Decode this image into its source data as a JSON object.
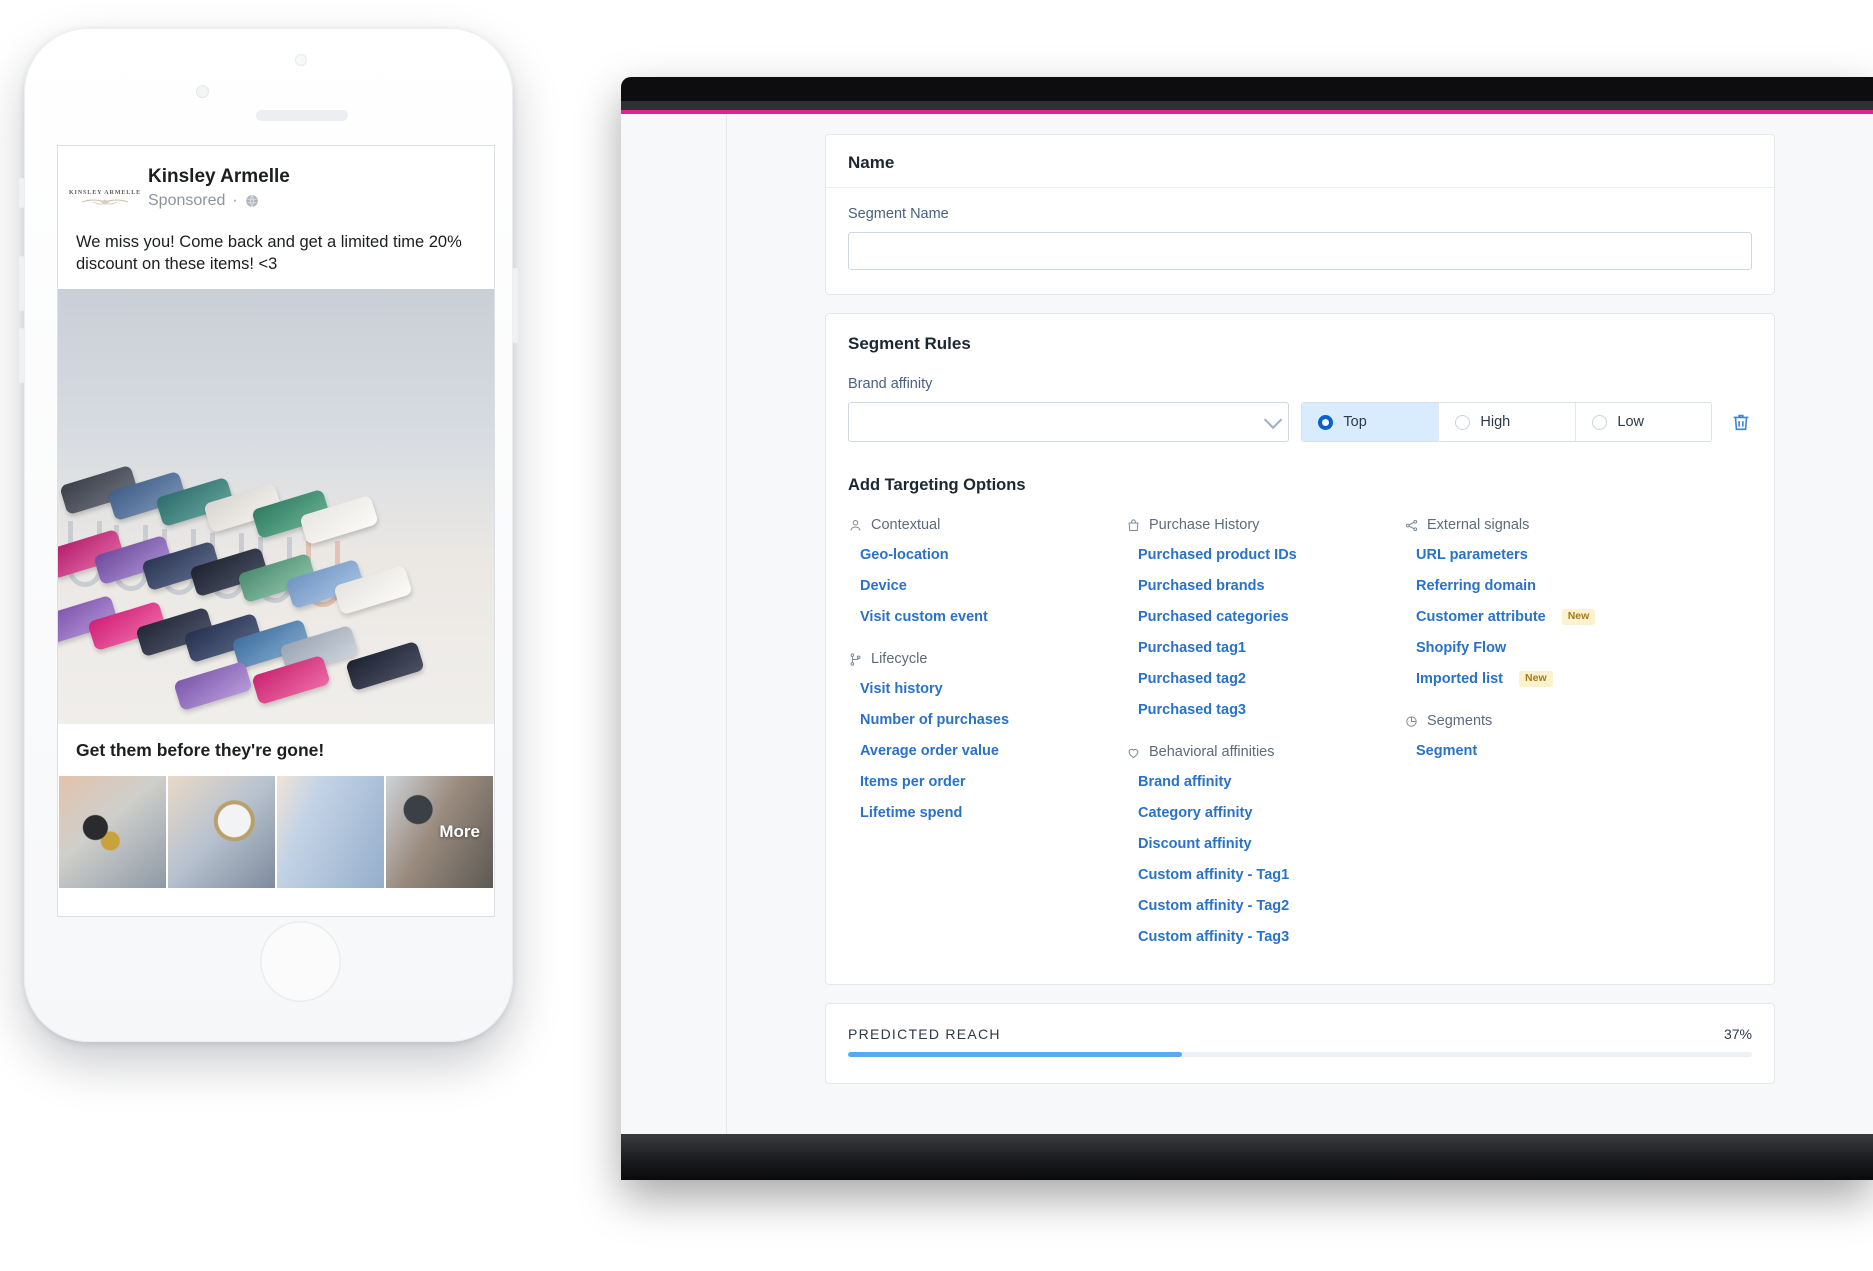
{
  "tablet": {
    "accent_color": "#e0219b",
    "name_card": {
      "title": "Name",
      "field_label": "Segment Name",
      "field_value": "",
      "field_placeholder": ""
    },
    "rules_card": {
      "title": "Segment Rules",
      "rule_label": "Brand affinity",
      "select_value": "",
      "segments": [
        {
          "label": "Top",
          "selected": true
        },
        {
          "label": "High",
          "selected": false
        },
        {
          "label": "Low",
          "selected": false
        }
      ],
      "delete_icon": "trash-icon"
    },
    "targeting": {
      "title": "Add Targeting Options",
      "columns": [
        {
          "groups": [
            {
              "heading": "Contextual",
              "icon": "person-icon",
              "items": [
                {
                  "label": "Geo-location"
                },
                {
                  "label": "Device"
                },
                {
                  "label": "Visit custom event"
                }
              ]
            },
            {
              "heading": "Lifecycle",
              "icon": "branch-icon",
              "items": [
                {
                  "label": "Visit history"
                },
                {
                  "label": "Number of purchases"
                },
                {
                  "label": "Average order value"
                },
                {
                  "label": "Items per order"
                },
                {
                  "label": "Lifetime spend"
                }
              ]
            }
          ]
        },
        {
          "groups": [
            {
              "heading": "Purchase History",
              "icon": "bag-icon",
              "items": [
                {
                  "label": "Purchased product IDs"
                },
                {
                  "label": "Purchased brands"
                },
                {
                  "label": "Purchased categories"
                },
                {
                  "label": "Purchased tag1"
                },
                {
                  "label": "Purchased tag2"
                },
                {
                  "label": "Purchased tag3"
                }
              ]
            },
            {
              "heading": "Behavioral affinities",
              "icon": "heart-icon",
              "items": [
                {
                  "label": "Brand affinity"
                },
                {
                  "label": "Category affinity"
                },
                {
                  "label": "Discount affinity"
                },
                {
                  "label": "Custom affinity - Tag1"
                },
                {
                  "label": "Custom affinity - Tag2"
                },
                {
                  "label": "Custom affinity - Tag3"
                }
              ]
            }
          ]
        },
        {
          "groups": [
            {
              "heading": "External signals",
              "icon": "share-nodes-icon",
              "items": [
                {
                  "label": "URL parameters"
                },
                {
                  "label": "Referring domain"
                },
                {
                  "label": "Customer attribute",
                  "badge": "New"
                },
                {
                  "label": "Shopify Flow"
                },
                {
                  "label": "Imported list",
                  "badge": "New"
                }
              ]
            },
            {
              "heading": "Segments",
              "icon": "pie-chart-icon",
              "items": [
                {
                  "label": "Segment"
                }
              ]
            }
          ]
        }
      ]
    },
    "predicted_reach": {
      "label": "PREDICTED REACH",
      "percent_text": "37%",
      "percent_value": 37,
      "bar_color": "#5aa8f0"
    }
  },
  "phone": {
    "ad": {
      "logo_text": "KINSLEY ARMELLE",
      "page_name": "Kinsley Armelle",
      "sponsored_label": "Sponsored",
      "separator": "·",
      "audience_icon": "globe-icon",
      "body_text": "We miss you! Come back and get a limited time 20% discount on these items! <3",
      "hero_alt": "druzy-stone-rings-photo",
      "caption": "Get them before they're gone!",
      "thumbnails": [
        {
          "alt": "stacked-bracelets-thumbnail"
        },
        {
          "alt": "watch-and-bracelets-thumbnail"
        },
        {
          "alt": "necklace-sweater-thumbnail"
        },
        {
          "alt": "beaded-bracelet-thumbnail",
          "overlay_label": "More"
        }
      ]
    }
  }
}
